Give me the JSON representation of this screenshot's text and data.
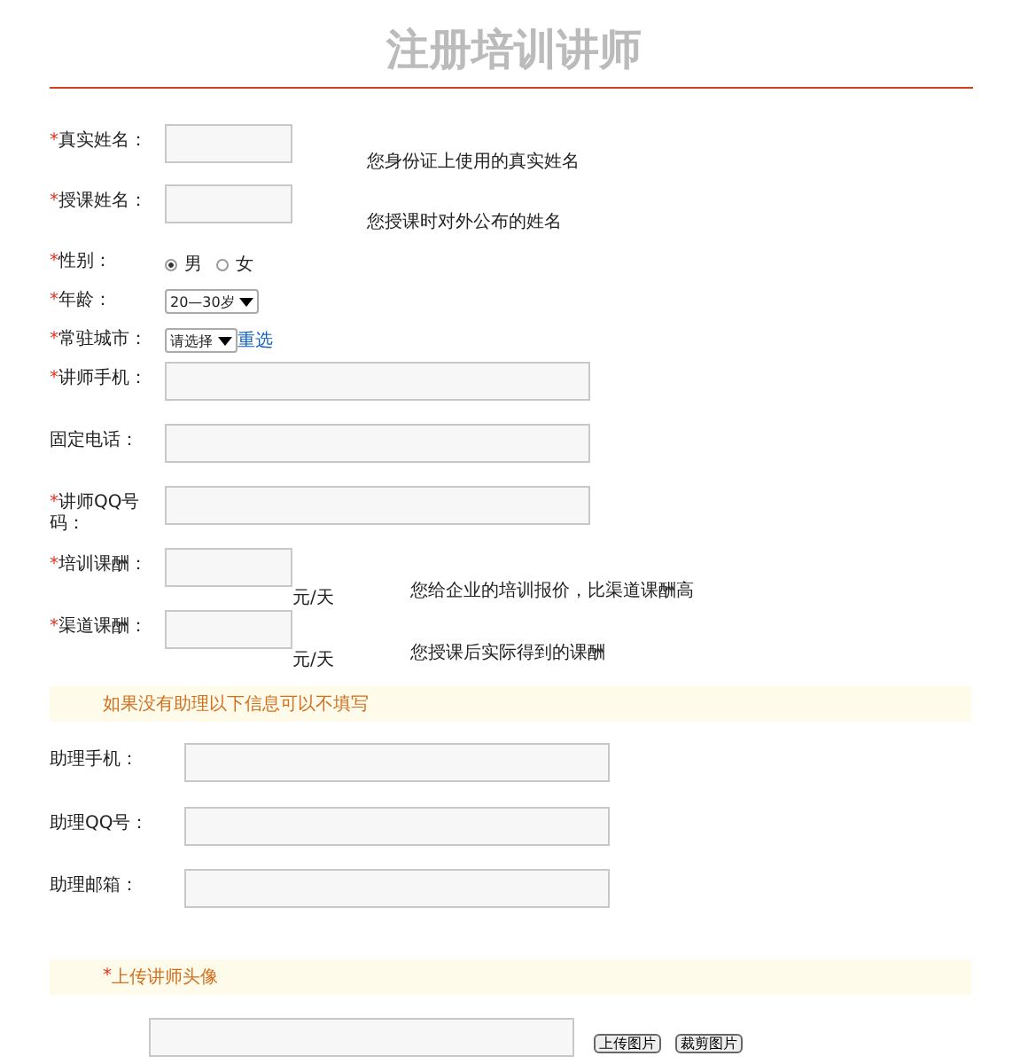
{
  "title": "注册培训讲师",
  "fields": [
    {
      "kind": "text_short",
      "mark": "*",
      "label": "真实姓名：",
      "note": "您身份证上使用的真实姓名"
    },
    {
      "kind": "text_short",
      "mark": "*",
      "label": "授课姓名：",
      "note": "您授课时对外公布的姓名"
    },
    {
      "kind": "radio",
      "mark": "*",
      "label": "性别：",
      "options": [
        {
          "label": "男",
          "selected": true
        },
        {
          "label": "女",
          "selected": false
        }
      ]
    },
    {
      "kind": "select",
      "mark": "*",
      "label": "年龄：",
      "value": "20—30岁"
    },
    {
      "kind": "select",
      "mark": "*",
      "label": "常驻城市：",
      "value": "请选择",
      "link": "重选"
    },
    {
      "kind": "text_long",
      "mark": "*",
      "label": "讲师手机："
    },
    {
      "kind": "text_long",
      "label": "固定电话："
    },
    {
      "kind": "text_long",
      "mark": "*",
      "label": "讲师QQ号码："
    },
    {
      "kind": "price",
      "mark": "*",
      "label": "培训课酬：",
      "unit": "元/天",
      "note": "您给企业的培训报价，比渠道课酬高"
    },
    {
      "kind": "price",
      "mark": "*",
      "label": "渠道课酬：",
      "unit": "元/天",
      "note": "您授课后实际得到的课酬"
    }
  ],
  "assistant_notice": "如果没有助理以下信息可以不填写",
  "assistant_fields": [
    {
      "label": "助理手机："
    },
    {
      "label": "助理QQ号："
    },
    {
      "label": "助理邮箱："
    }
  ],
  "upload": {
    "mark": "*",
    "label": "上传讲师头像",
    "buttons": [
      "上传图片",
      "裁剪图片"
    ]
  }
}
